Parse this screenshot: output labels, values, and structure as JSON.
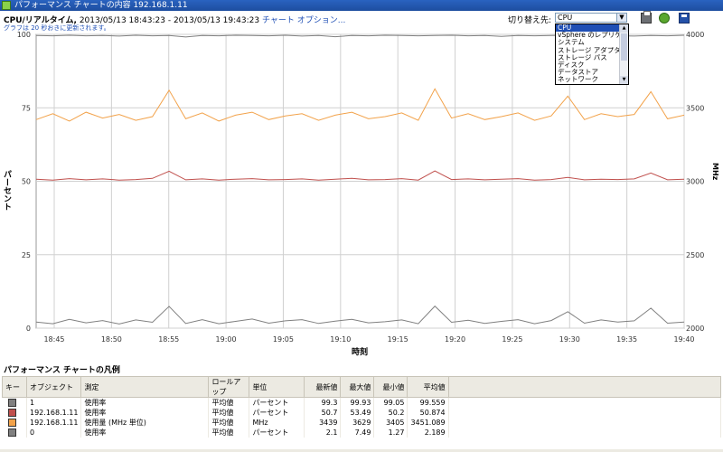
{
  "window": {
    "title": "パフォーマンス チャートの内容  192.168.1.11"
  },
  "header": {
    "title": "CPU/リアルタイム,",
    "range": "2013/05/13 18:43:23 - 2013/05/13 19:43:23",
    "options_link": "チャート オプション...",
    "note": "グラフは 20 秒おきに更新されます。",
    "switch_label": "切り替え先:",
    "switch_value": "CPU",
    "switch_arrow": "▼",
    "dropdown_options": [
      "CPU",
      "vSphere のレプリケーション",
      "システム",
      "ストレージ アダプタ",
      "ストレージ パス",
      "ディスク",
      "データストア",
      "ネットワーク"
    ],
    "dropdown_selected": 0,
    "icons": [
      "print-icon",
      "refresh-icon",
      "save-icon"
    ]
  },
  "chart_data": {
    "type": "line",
    "ylabel": "パーセント",
    "y2label": "MHz",
    "xlabel": "時刻",
    "ylim": [
      0,
      100
    ],
    "y2lim": [
      2000,
      4000
    ],
    "yticks": [
      "0",
      "25",
      "50",
      "75",
      "100"
    ],
    "y2ticks": [
      "2000",
      "2500",
      "3000",
      "3500",
      "4000"
    ],
    "categories": [
      "18:45",
      "18:50",
      "18:55",
      "19:00",
      "19:05",
      "19:10",
      "19:15",
      "19:20",
      "19:25",
      "19:30",
      "19:35",
      "19:40"
    ],
    "grid": true,
    "series": [
      {
        "name": "1 使用率",
        "axis": "left",
        "color": "#808080",
        "base": 99.5,
        "amp": 0.3,
        "spike_dir": -1,
        "spike": 0.4,
        "values": [
          99.6,
          99.5,
          99.7,
          99.5,
          99.6,
          99.4,
          99.7,
          99.5,
          99.6,
          99.1,
          99.6,
          99.5,
          99.7,
          99.6,
          99.5,
          99.7,
          99.4,
          99.6,
          99.2,
          99.6,
          99.5,
          99.7,
          99.6,
          99.5,
          99.6,
          99.7,
          99.5,
          99.6,
          99.3,
          99.6,
          99.5,
          99.6,
          99.7,
          99.5,
          99.6,
          99.5,
          99.4,
          99.6,
          99.5,
          99.7
        ]
      },
      {
        "name": "192.168.1.11 使用率",
        "axis": "left",
        "color": "#c0504d",
        "base": 50.6,
        "amp": 0.6,
        "spike_dir": 1,
        "spike": 2.9,
        "values": [
          50.7,
          50.4,
          50.9,
          50.5,
          50.8,
          50.4,
          50.6,
          51.0,
          53.4,
          50.5,
          50.8,
          50.4,
          50.7,
          50.9,
          50.5,
          50.6,
          50.8,
          50.4,
          50.7,
          51.0,
          50.5,
          50.6,
          50.9,
          50.4,
          53.5,
          50.6,
          50.8,
          50.5,
          50.7,
          50.9,
          50.4,
          50.6,
          51.3,
          50.5,
          50.7,
          50.6,
          50.8,
          52.8,
          50.5,
          50.7
        ]
      },
      {
        "name": "192.168.1.11 使用量 (MHz 単位)",
        "axis": "right",
        "color": "#f2a24a",
        "base": 3440,
        "amp": 30,
        "spike_dir": 1,
        "spike": 180,
        "values": [
          3420,
          3460,
          3410,
          3470,
          3430,
          3455,
          3415,
          3440,
          3620,
          3425,
          3465,
          3410,
          3450,
          3470,
          3420,
          3445,
          3460,
          3415,
          3450,
          3470,
          3425,
          3440,
          3465,
          3415,
          3629,
          3430,
          3460,
          3420,
          3440,
          3465,
          3415,
          3445,
          3580,
          3420,
          3460,
          3440,
          3455,
          3610,
          3425,
          3450
        ]
      },
      {
        "name": "0 使用率",
        "axis": "left",
        "color": "#808080",
        "base": 2.2,
        "amp": 1.2,
        "spike_dir": 1,
        "spike": 5,
        "values": [
          2.1,
          1.5,
          3.0,
          1.8,
          2.6,
          1.4,
          2.8,
          2.0,
          7.4,
          1.6,
          2.9,
          1.5,
          2.3,
          3.1,
          1.7,
          2.5,
          2.9,
          1.6,
          2.4,
          3.0,
          1.8,
          2.2,
          2.8,
          1.5,
          7.5,
          2.0,
          2.7,
          1.6,
          2.3,
          2.9,
          1.5,
          2.6,
          5.6,
          1.7,
          2.8,
          2.1,
          2.5,
          6.8,
          1.7,
          2.1
        ]
      }
    ]
  },
  "legend": {
    "title": "パフォーマンス チャートの凡例",
    "columns": [
      "キー",
      "オブジェクト",
      "測定",
      "ロールアップ",
      "単位",
      "最新値",
      "最大値",
      "最小値",
      "平均値"
    ],
    "rows": [
      {
        "color": "#808080",
        "object": "1",
        "measure": "使用率",
        "rollup": "平均値",
        "unit": "パーセント",
        "latest": "99.3",
        "max": "99.93",
        "min": "99.05",
        "avg": "99.559"
      },
      {
        "color": "#c0504d",
        "object": "192.168.1.11",
        "measure": "使用率",
        "rollup": "平均値",
        "unit": "パーセント",
        "latest": "50.7",
        "max": "53.49",
        "min": "50.2",
        "avg": "50.874"
      },
      {
        "color": "#f2a24a",
        "object": "192.168.1.11",
        "measure": "使用量 (MHz 単位)",
        "rollup": "平均値",
        "unit": "MHz",
        "latest": "3439",
        "max": "3629",
        "min": "3405",
        "avg": "3451.089"
      },
      {
        "color": "#808080",
        "object": "0",
        "measure": "使用率",
        "rollup": "平均値",
        "unit": "パーセント",
        "latest": "2.1",
        "max": "7.49",
        "min": "1.27",
        "avg": "2.189"
      }
    ]
  }
}
